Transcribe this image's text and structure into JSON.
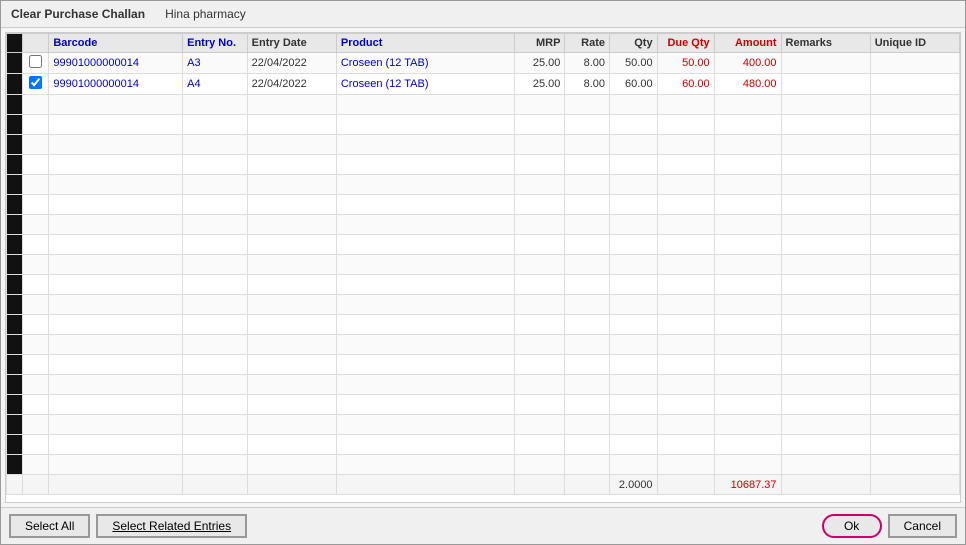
{
  "title": {
    "app_name": "Clear Purchase Challan",
    "pharmacy": "Hina pharmacy"
  },
  "columns": [
    {
      "key": "sidebar",
      "label": ""
    },
    {
      "key": "checkbox",
      "label": ""
    },
    {
      "key": "barcode",
      "label": "Barcode"
    },
    {
      "key": "entry_no",
      "label": "Entry No."
    },
    {
      "key": "entry_date",
      "label": "Entry Date"
    },
    {
      "key": "product",
      "label": "Product"
    },
    {
      "key": "mrp",
      "label": "MRP"
    },
    {
      "key": "rate",
      "label": "Rate"
    },
    {
      "key": "qty",
      "label": "Qty"
    },
    {
      "key": "due_qty",
      "label": "Due Qty"
    },
    {
      "key": "amount",
      "label": "Amount"
    },
    {
      "key": "remarks",
      "label": "Remarks"
    },
    {
      "key": "unique_id",
      "label": "Unique ID"
    }
  ],
  "rows": [
    {
      "checked": false,
      "barcode": "99901000000014",
      "entry_no": "A3",
      "entry_date": "22/04/2022",
      "product": "Croseen (12 TAB)",
      "mrp": "25.00",
      "rate": "8.00",
      "qty": "50.00",
      "due_qty": "50.00",
      "amount": "400.00",
      "remarks": "",
      "unique_id": ""
    },
    {
      "checked": true,
      "barcode": "99901000000014",
      "entry_no": "A4",
      "entry_date": "22/04/2022",
      "product": "Croseen (12 TAB)",
      "mrp": "25.00",
      "rate": "8.00",
      "qty": "60.00",
      "due_qty": "60.00",
      "amount": "480.00",
      "remarks": "",
      "unique_id": ""
    }
  ],
  "summary": {
    "qty_total": "2.0000",
    "amount_total": "10687.37"
  },
  "empty_rows": 20,
  "buttons": {
    "select_all": "Select All",
    "select_related": "Select Related Entries",
    "ok": "Ok",
    "cancel": "Cancel"
  }
}
